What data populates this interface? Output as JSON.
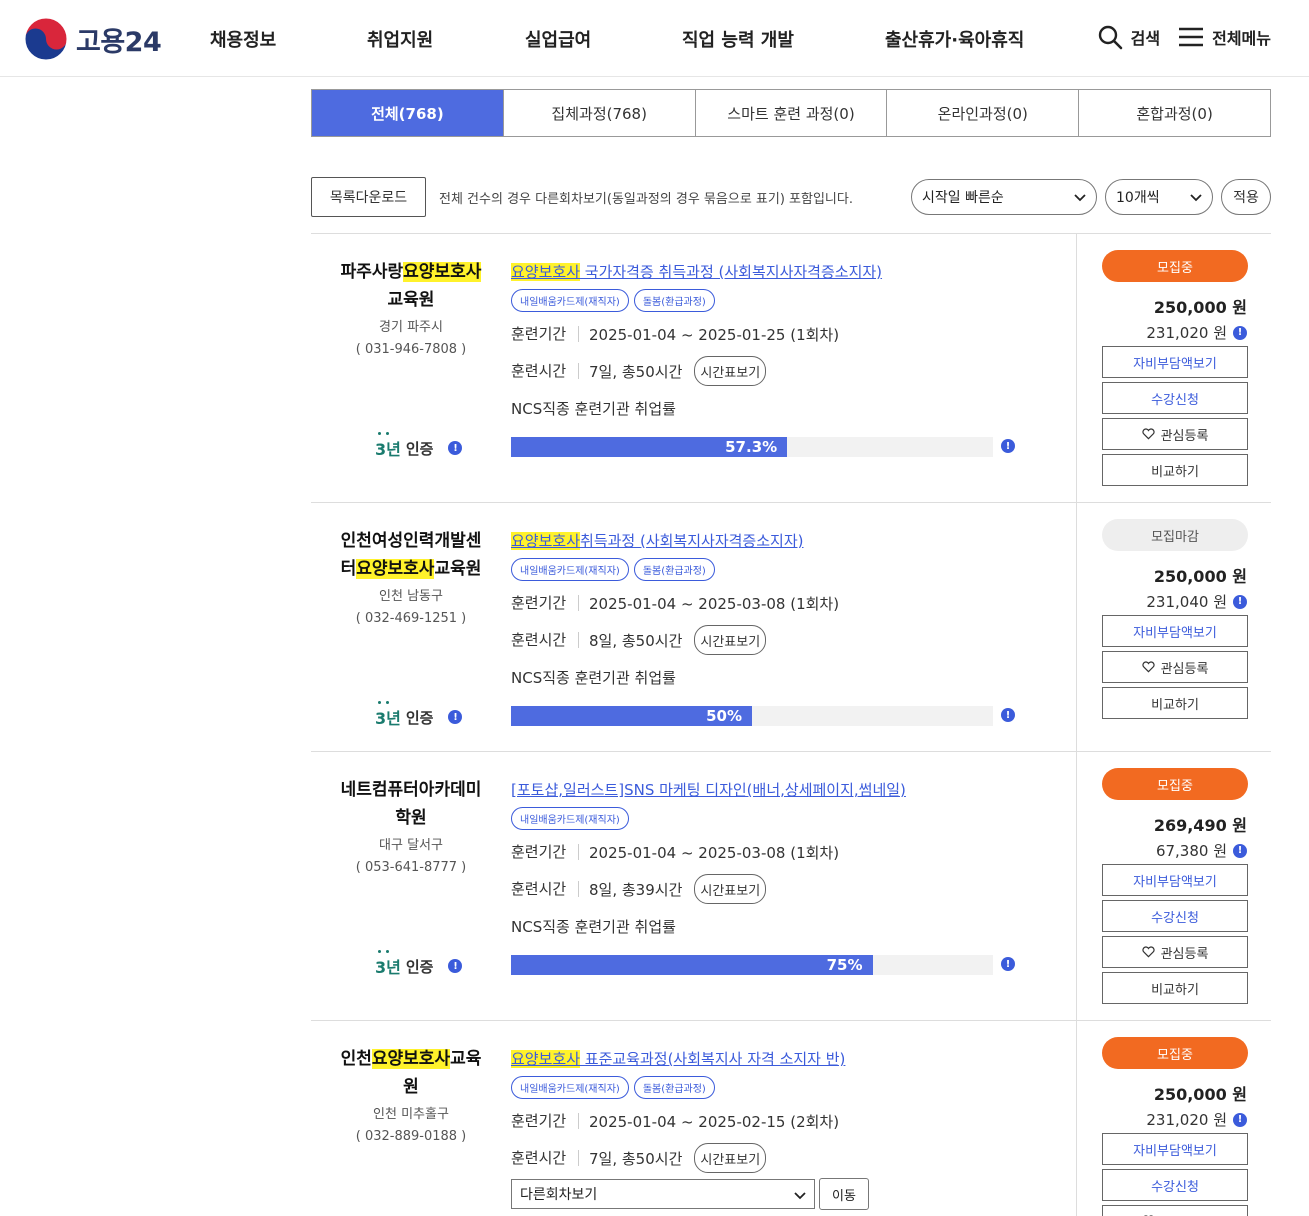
{
  "header": {
    "logo_text": "고용24",
    "nav": [
      "채용정보",
      "취업지원",
      "실업급여",
      "직업 능력 개발",
      "출산휴가·육아휴직"
    ],
    "search_label": "검색",
    "menu_label": "전체메뉴"
  },
  "tabs": [
    {
      "label": "전체(768)",
      "active": true
    },
    {
      "label": "집체과정(768)",
      "active": false
    },
    {
      "label": "스마트 훈련 과정(0)",
      "active": false
    },
    {
      "label": "온라인과정(0)",
      "active": false
    },
    {
      "label": "혼합과정(0)",
      "active": false
    }
  ],
  "toolbar": {
    "download_label": "목록다운로드",
    "note": "전체 건수의 경우 다른회차보기(동일과정의 경우 묶음으로 표기) 포함입니다.",
    "sort_value": "시작일 빠른순",
    "count_value": "10개씩",
    "apply_label": "적용"
  },
  "labels": {
    "period": "훈련기간",
    "hours": "훈련시간",
    "timetable": "시간표보기",
    "ncs": "NCS직종 훈련기관 취업률",
    "cert_year": "3년",
    "cert_text": "인증",
    "cost_view": "자비부담액보기",
    "apply": "수강신청",
    "favorite": "관심등록",
    "compare": "비교하기",
    "other_rounds": "다른회차보기",
    "move": "이동"
  },
  "courses": [
    {
      "inst_pre": "파주사랑",
      "inst_hl": "요양보호사",
      "inst_post": "교육원",
      "region": "경기 파주시",
      "tel": "( 031-946-7808 )",
      "title_hl": "요양보호사",
      "title_rest": " 국가자격증 취득과정 (사회복지사자격증소지자)",
      "badges": [
        "내일배움카드제(재직자)",
        "돌봄(환급과정)"
      ],
      "period": "2025-01-04 ~ 2025-01-25 (1회차)",
      "hours": "7일, 총50시간",
      "rate_label": "57.3%",
      "rate": 57.3,
      "status": "모집중",
      "status_type": "open",
      "price": "250,000 원",
      "subsidy": "231,020 원"
    },
    {
      "inst_pre": "인천여성인력개발센터",
      "inst_hl": "요양보호사",
      "inst_post": "교육원",
      "region": "인천 남동구",
      "tel": "( 032-469-1251 )",
      "title_hl": "요양보호사",
      "title_rest": "취득과정 (사회복지사자격증소지자)",
      "badges": [
        "내일배움카드제(재직자)",
        "돌봄(환급과정)"
      ],
      "period": "2025-01-04 ~ 2025-03-08 (1회차)",
      "hours": "8일, 총50시간",
      "rate_label": "50%",
      "rate": 50,
      "status": "모집마감",
      "status_type": "closed",
      "price": "250,000 원",
      "subsidy": "231,040 원"
    },
    {
      "inst_pre": "네트컴퓨터아카데미학원",
      "inst_hl": "",
      "inst_post": "",
      "region": "대구 달서구",
      "tel": "( 053-641-8777 )",
      "title_hl": "",
      "title_rest": "[포토샵,일러스트]SNS 마케팅 디자인(배너,상세페이지,썸네일)",
      "badges": [
        "내일배움카드제(재직자)"
      ],
      "period": "2025-01-04 ~ 2025-03-08 (1회차)",
      "hours": "8일, 총39시간",
      "rate_label": "75%",
      "rate": 75,
      "status": "모집중",
      "status_type": "open",
      "price": "269,490 원",
      "subsidy": "67,380 원"
    },
    {
      "inst_pre": "인천",
      "inst_hl": "요양보호사",
      "inst_post": "교육원",
      "region": "인천 미추홀구",
      "tel": "( 032-889-0188 )",
      "title_hl": "요양보호사",
      "title_rest": " 표준교육과정(사회복지사 자격 소지자 반)",
      "badges": [
        "내일배움카드제(재직자)",
        "돌봄(환급과정)"
      ],
      "period": "2025-01-04 ~ 2025-02-15 (2회차)",
      "hours": "7일, 총50시간",
      "status": "모집중",
      "status_type": "open",
      "price": "250,000 원",
      "subsidy": "231,020 원"
    }
  ]
}
